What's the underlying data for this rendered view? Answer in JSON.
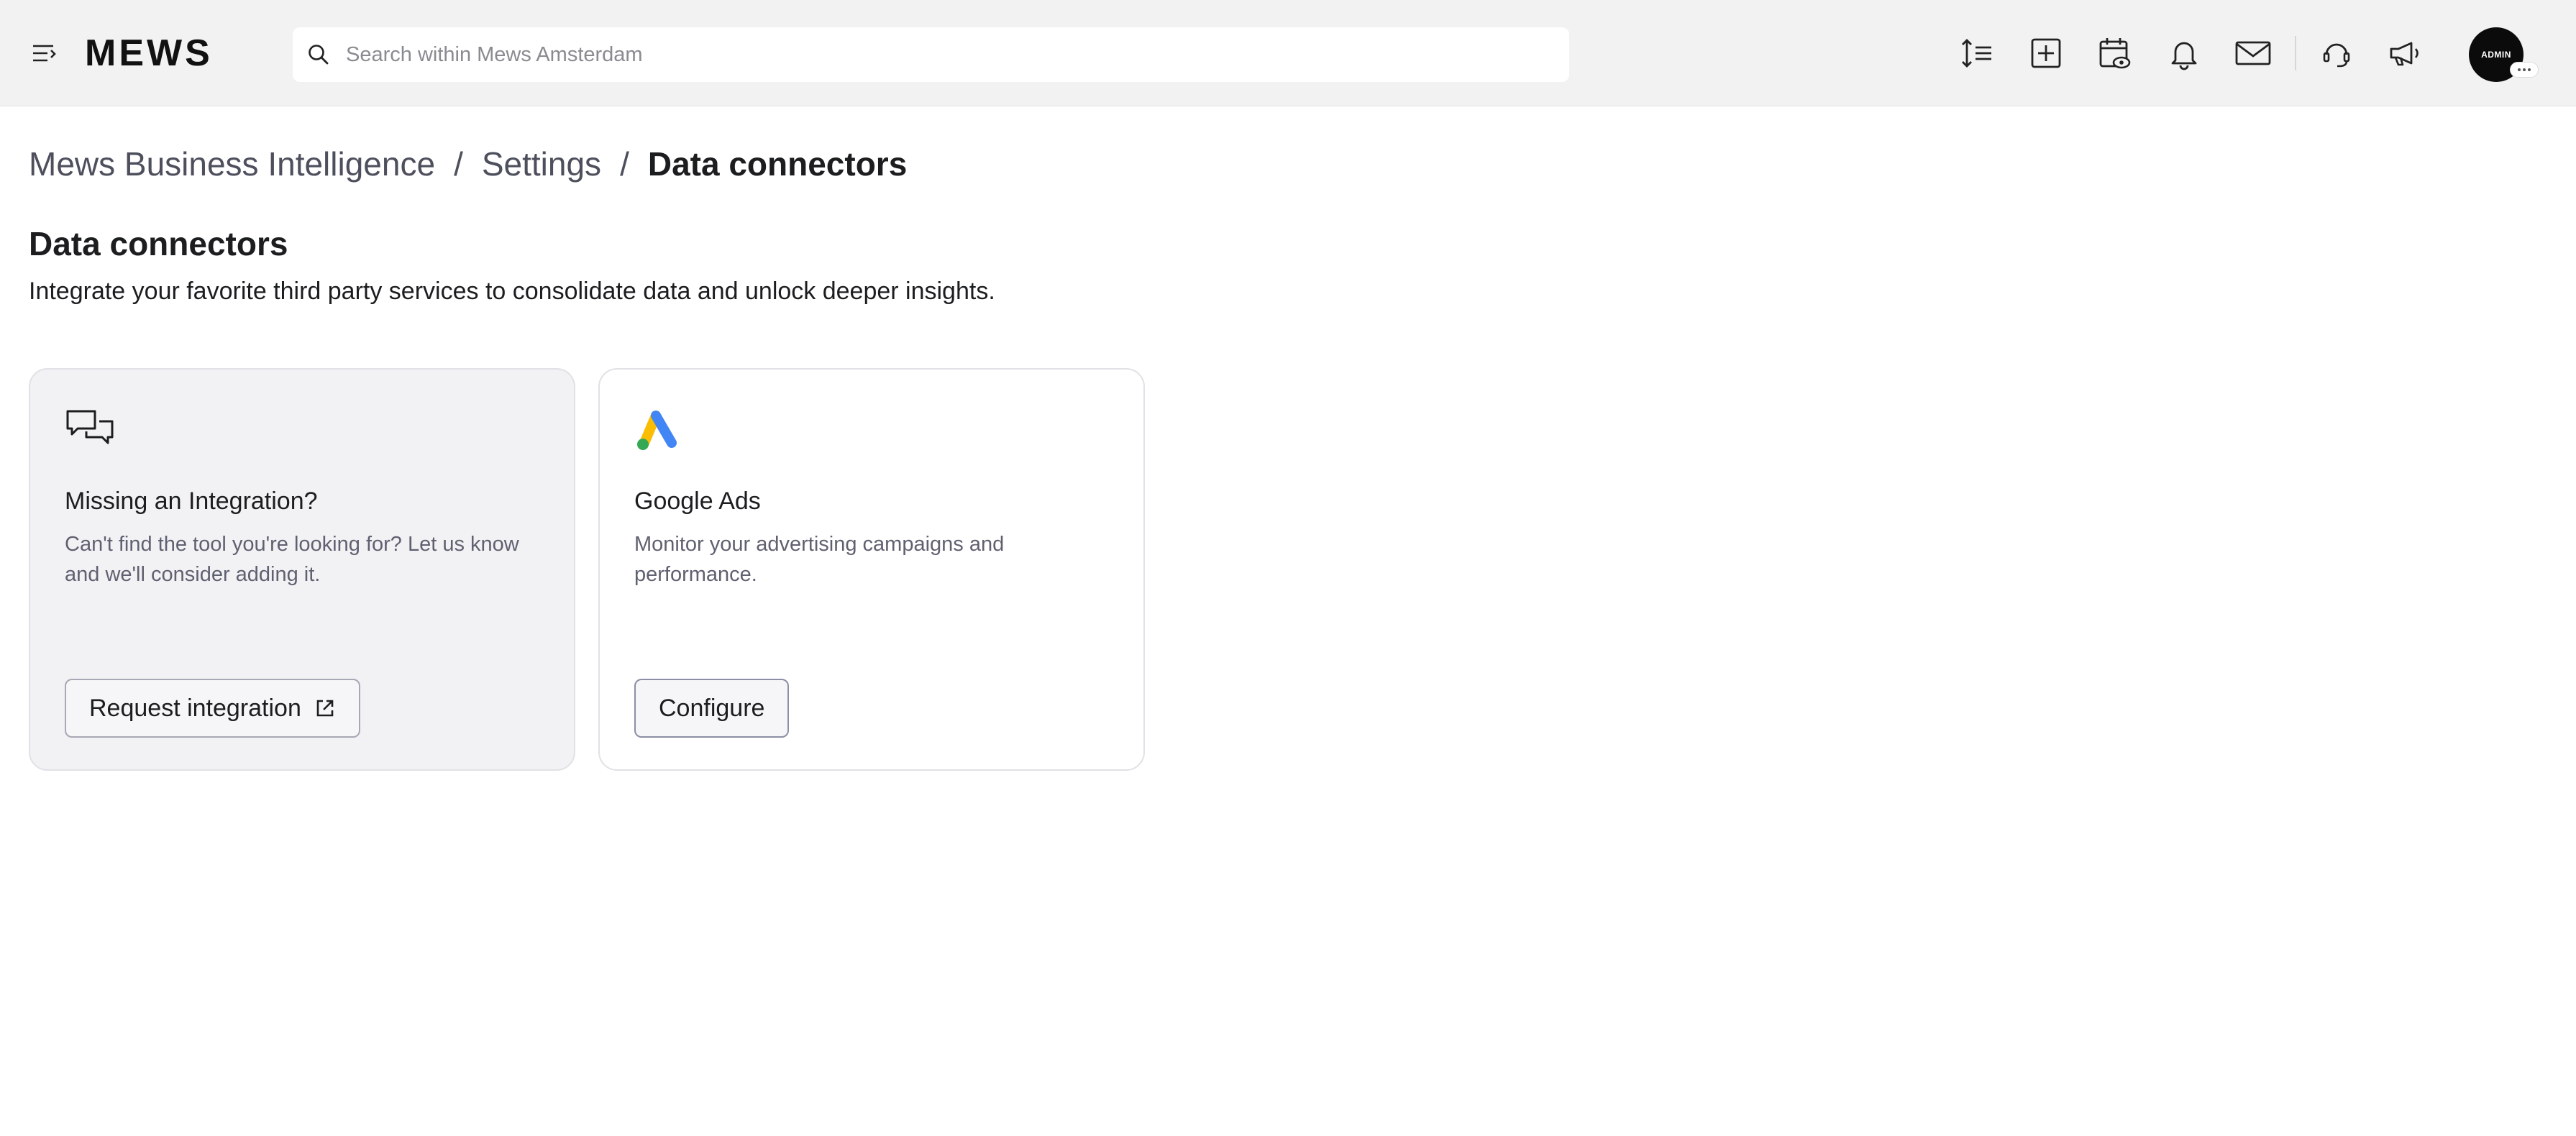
{
  "header": {
    "logo_text": "MEWS",
    "search": {
      "placeholder": "Search within Mews Amsterdam",
      "value": ""
    },
    "avatar_label": "ADMIN",
    "icons": [
      "menu-icon",
      "sort-lines-icon",
      "add-square-icon",
      "calendar-view-icon",
      "bell-icon",
      "mail-icon",
      "support-icon",
      "announcement-icon"
    ]
  },
  "breadcrumb": {
    "items": [
      "Mews Business Intelligence",
      "Settings"
    ],
    "separator": "/",
    "current": "Data connectors"
  },
  "page": {
    "title": "Data connectors",
    "subtitle": "Integrate your favorite third party services to consolidate data and unlock deeper insights."
  },
  "cards": [
    {
      "title": "Missing an Integration?",
      "description": "Can't find the tool you're looking for? Let us know and we'll consider adding it.",
      "button_label": "Request integration",
      "icon": "chat-bubbles-icon"
    },
    {
      "title": "Google Ads",
      "description": "Monitor your advertising campaigns and performance.",
      "button_label": "Configure",
      "icon": "google-ads-logo"
    }
  ],
  "colors": {
    "topbar_bg": "#f2f2f2",
    "card_muted_bg": "#f2f2f5",
    "google_blue": "#4285F4",
    "google_yellow": "#FBBC04",
    "google_green": "#34A853"
  }
}
